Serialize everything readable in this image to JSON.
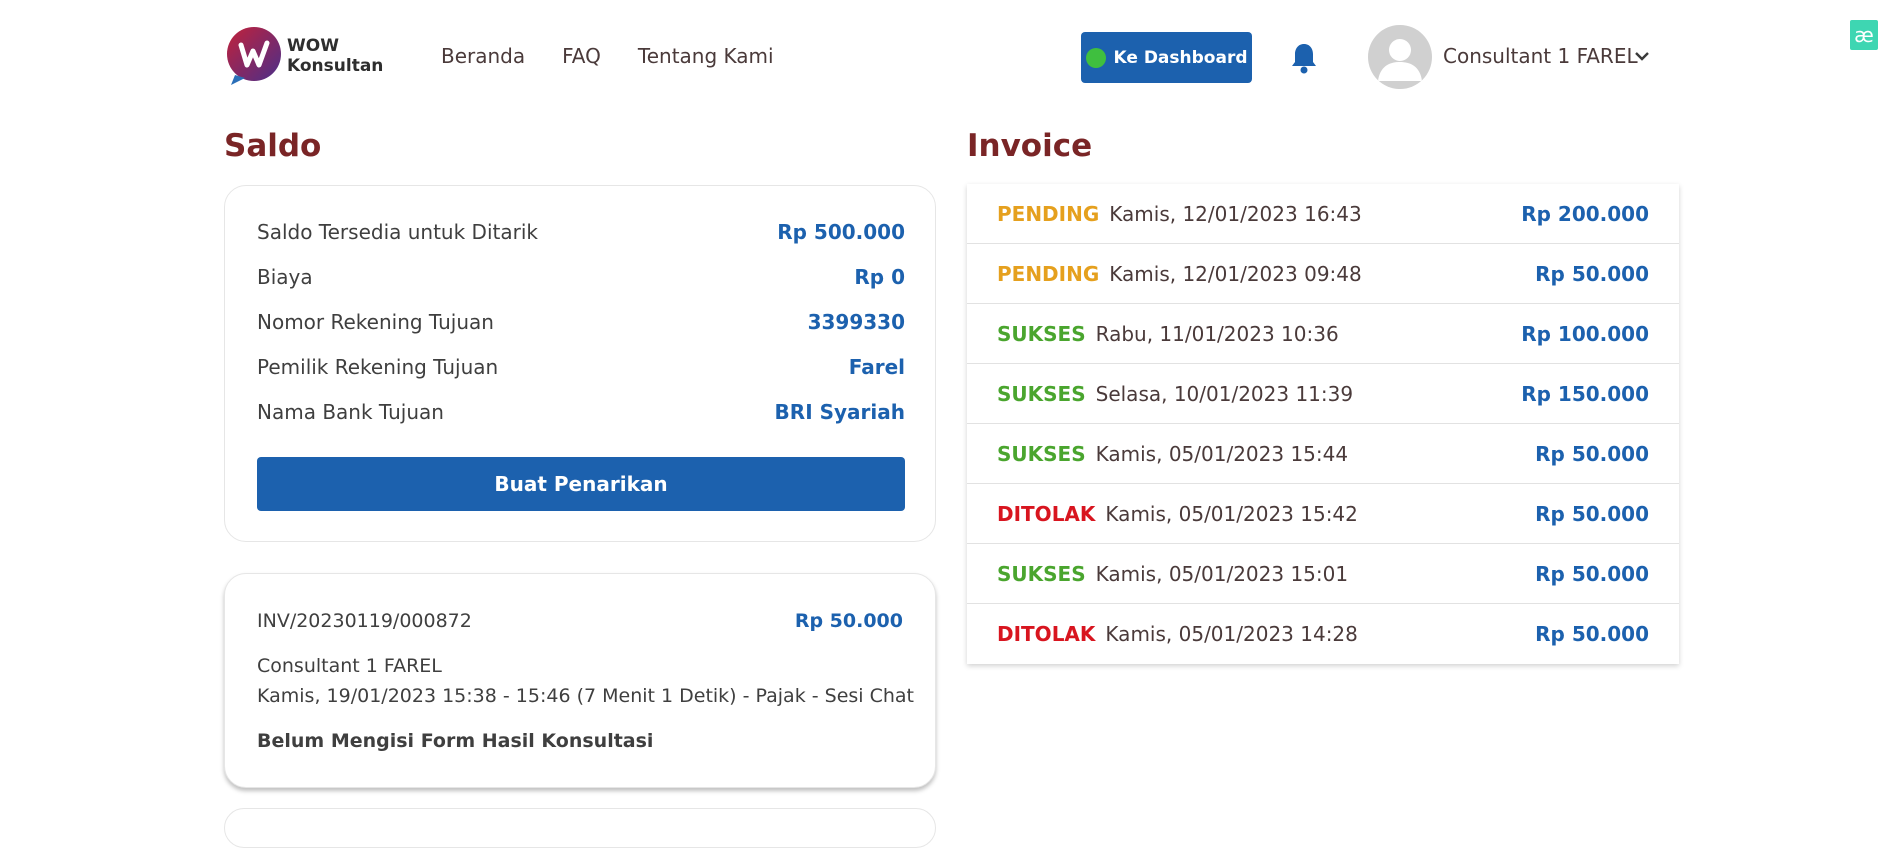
{
  "header": {
    "logo_text_line1": "WOW",
    "logo_text_line2": "Konsultan",
    "nav": [
      "Beranda",
      "FAQ",
      "Tentang Kami"
    ],
    "dashboard_button": "Ke Dashboard",
    "user_name": "Consultant 1 FAREL",
    "corner_badge": "æ"
  },
  "saldo": {
    "title": "Saldo",
    "rows": [
      {
        "label": "Saldo Tersedia untuk Ditarik",
        "value": "Rp 500.000"
      },
      {
        "label": "Biaya",
        "value": "Rp 0"
      },
      {
        "label": "Nomor Rekening Tujuan",
        "value": "3399330"
      },
      {
        "label": "Pemilik Rekening Tujuan",
        "value": "Farel"
      },
      {
        "label": "Nama Bank Tujuan",
        "value": "BRI Syariah"
      }
    ],
    "withdraw_button": "Buat Penarikan"
  },
  "session_card": {
    "invoice_no": "INV/20230119/000872",
    "amount": "Rp 50.000",
    "consultant": "Consultant 1 FAREL",
    "details": "Kamis, 19/01/2023 15:38 - 15:46 (7 Menit 1 Detik) - Pajak - Sesi Chat",
    "status": "Belum Mengisi Form Hasil Konsultasi"
  },
  "invoice": {
    "title": "Invoice",
    "items": [
      {
        "status": "PENDING",
        "date": "Kamis, 12/01/2023 16:43",
        "amount": "Rp 200.000"
      },
      {
        "status": "PENDING",
        "date": "Kamis, 12/01/2023 09:48",
        "amount": "Rp 50.000"
      },
      {
        "status": "SUKSES",
        "date": "Rabu, 11/01/2023 10:36",
        "amount": "Rp 100.000"
      },
      {
        "status": "SUKSES",
        "date": "Selasa, 10/01/2023 11:39",
        "amount": "Rp 150.000"
      },
      {
        "status": "SUKSES",
        "date": "Kamis, 05/01/2023 15:44",
        "amount": "Rp 50.000"
      },
      {
        "status": "DITOLAK",
        "date": "Kamis, 05/01/2023 15:42",
        "amount": "Rp 50.000"
      },
      {
        "status": "SUKSES",
        "date": "Kamis, 05/01/2023 15:01",
        "amount": "Rp 50.000"
      },
      {
        "status": "DITOLAK",
        "date": "Kamis, 05/01/2023 14:28",
        "amount": "Rp 50.000"
      }
    ]
  },
  "colors": {
    "primary": "#1c61ae",
    "heading": "#7a2526",
    "pending": "#e5a01e",
    "success": "#4aa52e",
    "rejected": "#d8151f"
  },
  "icons": [
    "logo-mark",
    "online-dot-icon",
    "bell-icon",
    "user-avatar-icon",
    "chevron-down-icon"
  ]
}
